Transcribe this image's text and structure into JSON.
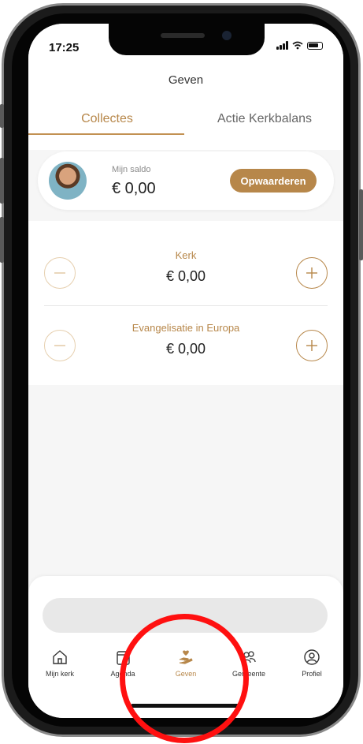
{
  "status_bar": {
    "time": "17:25"
  },
  "header": {
    "title": "Geven"
  },
  "tabs": [
    {
      "label": "Collectes",
      "active": true
    },
    {
      "label": "Actie Kerkbalans",
      "active": false
    }
  ],
  "balance": {
    "label": "Mijn saldo",
    "value": "€ 0,00",
    "topup_label": "Opwaarderen"
  },
  "collections": [
    {
      "name": "Kerk",
      "amount": "€ 0,00"
    },
    {
      "name": "Evangelisatie in Europa",
      "amount": "€ 0,00"
    }
  ],
  "nav": [
    {
      "label": "Mijn kerk",
      "icon": "home-icon",
      "active": false
    },
    {
      "label": "Agenda",
      "icon": "calendar-icon",
      "active": false
    },
    {
      "label": "Geven",
      "icon": "giving-hand-icon",
      "active": true
    },
    {
      "label": "Gemeente",
      "icon": "people-icon",
      "active": false
    },
    {
      "label": "Profiel",
      "icon": "profile-icon",
      "active": false
    }
  ],
  "colors": {
    "accent": "#b7874a",
    "annotation": "#ff1010"
  }
}
